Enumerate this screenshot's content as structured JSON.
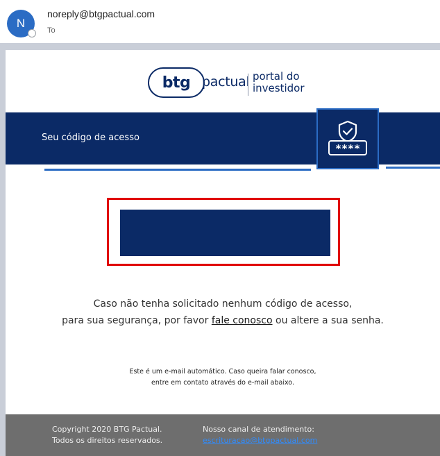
{
  "header": {
    "avatar_initial": "N",
    "sender": "noreply@btgpactual.com",
    "to_label": "To"
  },
  "logo": {
    "brand_mark": "btg",
    "brand_word": "pactual",
    "portal_line1": "portal do",
    "portal_line2": "investidor"
  },
  "banner": {
    "title": "Seu código de acesso",
    "icon": "shield-check-password-icon",
    "password_mask": "****"
  },
  "code": {
    "value": ""
  },
  "notice": {
    "line1": "Caso não tenha solicitado nenhum código de acesso,",
    "line2_prefix": "para sua segurança, por favor ",
    "link": "fale conosco",
    "line2_suffix": " ou altere a sua senha."
  },
  "auto_note": {
    "line1": "Este é um e-mail automático. Caso queira falar conosco,",
    "line2": "entre em contato através do e-mail abaixo."
  },
  "footer": {
    "copyright": "Copyright 2020 BTG Pactual.",
    "rights": "Todos os direitos reservados.",
    "channel_label": "Nosso canal de atendimento:",
    "channel_email": "escrituracao@btgpactual.com"
  },
  "colors": {
    "brand_navy": "#0b2a66",
    "accent_blue": "#2b6cc4",
    "highlight_red": "#e00000",
    "footer_grey": "#6e6e6e"
  }
}
